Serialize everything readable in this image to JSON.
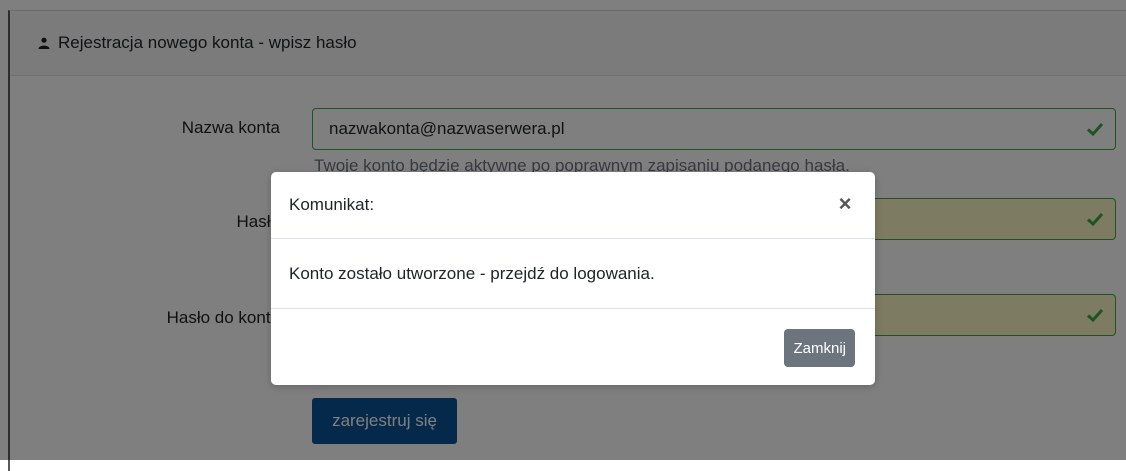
{
  "panel": {
    "header_title": "Rejestracja nowego konta - wpisz hasło"
  },
  "form": {
    "account_label": "Nazwa konta",
    "account_value": "nazwakonta@nazwaserwera.pl",
    "account_help": "Twoje konto będzie aktywne po poprawnym zapisaniu podanego hasła.",
    "password_label": "Hasło",
    "password_confirm_label": "Hasło do konta",
    "register_button": "zarejestruj się"
  },
  "modal": {
    "title": "Komunikat:",
    "close_icon_glyph": "×",
    "message": "Konto zostało utworzone - przejdź do logowania.",
    "close_button": "Zamknij"
  },
  "colors": {
    "valid_border": "#38a847",
    "register_button_bg": "#0b5394",
    "close_button_bg": "#6c757d"
  }
}
